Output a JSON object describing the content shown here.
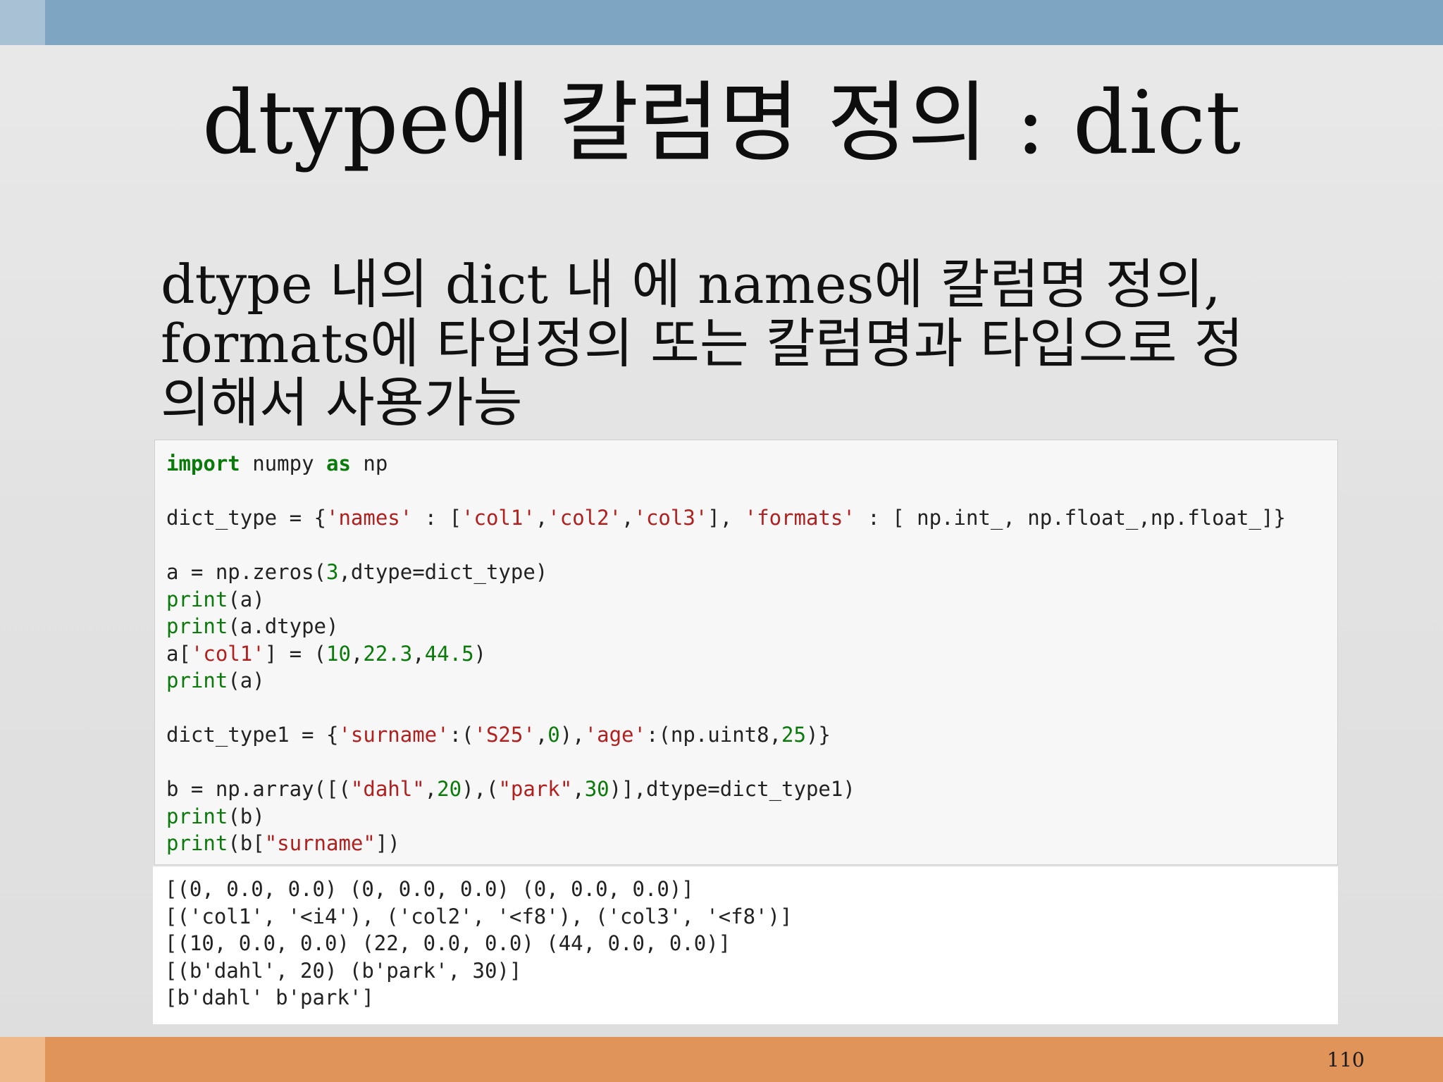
{
  "slide": {
    "title": "dtype에 칼럼명 정의 : dict",
    "body_lines": [
      "dtype 내의 dict 내 에 names에 칼럼명 정의,",
      "formats에 타입정의 또는 칼럼명과 타입으로 정",
      "의해서 사용가능"
    ],
    "page_number": "110"
  },
  "code": {
    "line1": {
      "kw_import": "import",
      "a": " numpy ",
      "kw_as": "as",
      "b": " np"
    },
    "line2": {
      "a": "dict_type = {",
      "s_names": "'names'",
      "b": " : [",
      "s_col1": "'col1'",
      "c1": ",",
      "s_col2": "'col2'",
      "c2": ",",
      "s_col3": "'col3'",
      "d": "], ",
      "s_formats": "'formats'",
      "e": " : [ np.int_, np.float_,np.float_]}"
    },
    "line3": {
      "a": "a = np.zeros(",
      "n3": "3",
      "b": ",dtype=dict_type)"
    },
    "line4": {
      "fn": "print",
      "a": "(a)"
    },
    "line5": {
      "fn": "print",
      "a": "(a.dtype)"
    },
    "line6": {
      "a": "a[",
      "s": "'col1'",
      "b": "] = (",
      "n1": "10",
      "c1": ",",
      "n2": "22.3",
      "c2": ",",
      "n3": "44.5",
      "d": ")"
    },
    "line7": {
      "fn": "print",
      "a": "(a)"
    },
    "line8": {
      "a": "dict_type1 = {",
      "s_surname": "'surname'",
      "b": ":(",
      "s_s25": "'S25'",
      "c": ",",
      "n0": "0",
      "d": "),",
      "s_age": "'age'",
      "e": ":(np.uint8,",
      "n25": "25",
      "f": ")}"
    },
    "line9": {
      "a": "b = np.array([(",
      "s_dahl": "\"dahl\"",
      "c1": ",",
      "n20": "20",
      "b": "),(",
      "s_park": "\"park\"",
      "c2": ",",
      "n30": "30",
      "d": ")],dtype=dict_type1)"
    },
    "line10": {
      "fn": "print",
      "a": "(b)"
    },
    "line11": {
      "fn": "print",
      "a": "(b[",
      "s": "\"surname\"",
      "b": "])"
    }
  },
  "output": [
    "[(0, 0.0, 0.0) (0, 0.0, 0.0) (0, 0.0, 0.0)]",
    "[('col1', '<i4'), ('col2', '<f8'), ('col3', '<f8')]",
    "[(10, 0.0, 0.0) (22, 0.0, 0.0) (44, 0.0, 0.0)]",
    "[(b'dahl', 20) (b'park', 30)]",
    "[b'dahl' b'park']"
  ]
}
